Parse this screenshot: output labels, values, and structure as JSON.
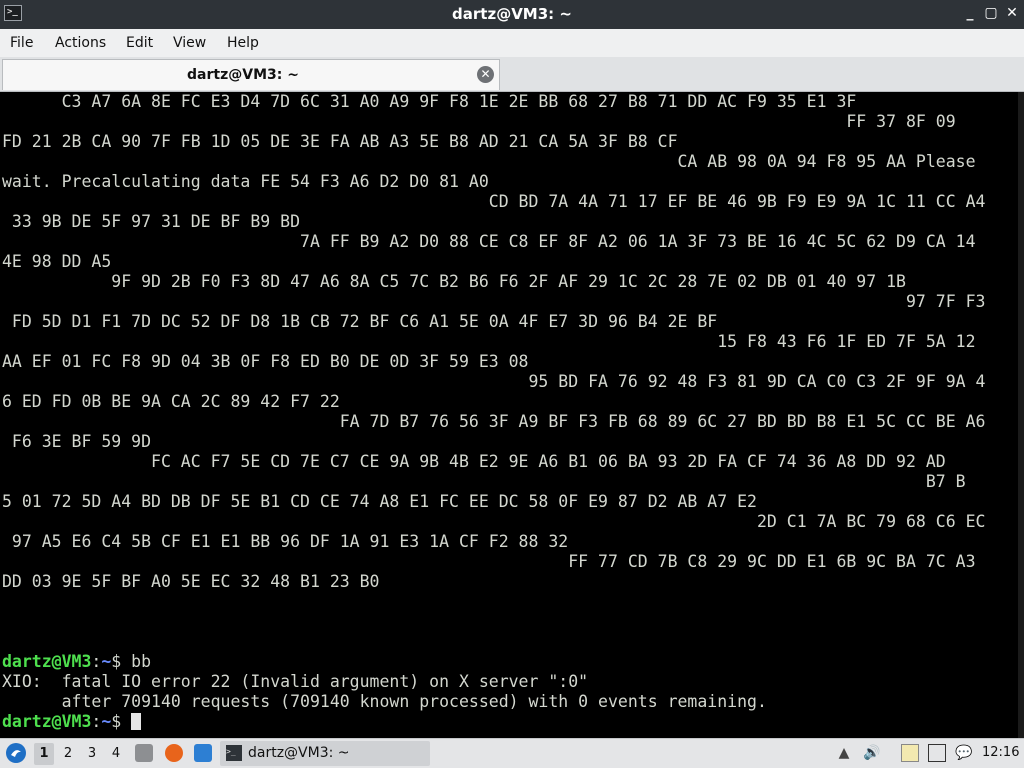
{
  "window": {
    "title": "dartz@VM3: ~",
    "controls": [
      "_",
      "▢",
      "✕"
    ]
  },
  "menu": [
    "File",
    "Actions",
    "Edit",
    "View",
    "Help"
  ],
  "tab": {
    "label": "dartz@VM3: ~",
    "close": "✕"
  },
  "terminal": {
    "lines": [
      "      C3 A7 6A 8E FC E3 D4 7D 6C 31 A0 A9 9F F8 1E 2E BB 68 27 B8 71 DD AC F9 35 E1 3F",
      "                                                                                     FF 37 8F 09",
      "FD 21 2B CA 90 7F FB 1D 05 DE 3E FA AB A3 5E B8 AD 21 CA 5A 3F B8 CF",
      "                                                                    CA AB 98 0A 94 F8 95 AA Please",
      "wait. Precalculating data FE 54 F3 A6 D2 D0 81 A0",
      "                                                 CD BD 7A 4A 71 17 EF BE 46 9B F9 E9 9A 1C 11 CC A4",
      " 33 9B DE 5F 97 31 DE BF B9 BD",
      "                              7A FF B9 A2 D0 88 CE C8 EF 8F A2 06 1A 3F 73 BE 16 4C 5C 62 D9 CA 14",
      "4E 98 DD A5",
      "           9F 9D 2B F0 F3 8D 47 A6 8A C5 7C B2 B6 F6 2F AF 29 1C 2C 28 7E 02 DB 01 40 97 1B",
      "                                                                                           97 7F F3",
      " FD 5D D1 F1 7D DC 52 DF D8 1B CB 72 BF C6 A1 5E 0A 4F E7 3D 96 B4 2E BF",
      "                                                                        15 F8 43 F6 1F ED 7F 5A 12",
      "AA EF 01 FC F8 9D 04 3B 0F F8 ED B0 DE 0D 3F 59 E3 08",
      "                                                     95 BD FA 76 92 48 F3 81 9D CA C0 C3 2F 9F 9A 4",
      "6 ED FD 0B BE 9A CA 2C 89 42 F7 22",
      "                                  FA 7D B7 76 56 3F A9 BF F3 FB 68 89 6C 27 BD BD B8 E1 5C CC BE A6",
      " F6 3E BF 59 9D",
      "               FC AC F7 5E CD 7E C7 CE 9A 9B 4B E2 9E A6 B1 06 BA 93 2D FA CF 74 36 A8 DD 92 AD",
      "                                                                                             B7 B",
      "5 01 72 5D A4 BD DB DF 5E B1 CD CE 74 A8 E1 FC EE DC 58 0F E9 87 D2 AB A7 E2",
      "                                                                            2D C1 7A BC 79 68 C6 EC",
      " 97 A5 E6 C4 5B CF E1 E1 BB 96 DF 1A 91 E3 1A CF F2 88 32",
      "                                                         FF 77 CD 7B C8 29 9C DD E1 6B 9C BA 7C A3",
      "DD 03 9E 5F BF A0 5E EC 32 48 B1 23 B0",
      "",
      "",
      ""
    ],
    "prompt_user": "dartz@VM3",
    "prompt_sep": ":",
    "prompt_path": "~",
    "prompt_dollar": "$ ",
    "command1": "bb",
    "error_line1": "XIO:  fatal IO error 22 (Invalid argument) on X server \":0\"",
    "error_line2": "      after 709140 requests (709140 known processed) with 0 events remaining.",
    "colors": {
      "user": "#4ee04e",
      "path": "#6a8cff",
      "text": "#d3d7cf",
      "background": "#000000"
    }
  },
  "taskbar": {
    "desktops": [
      "1",
      "2",
      "3",
      "4"
    ],
    "active_desktop": "1",
    "launchers": [
      "file-manager-icon",
      "firefox-icon",
      "desktop-icon"
    ],
    "task_label": "dartz@VM3: ~",
    "tray_icons": [
      "tray-app-icon",
      "volume-icon",
      "clipboard-icon",
      "network-icon",
      "notification-icon"
    ],
    "clock": "12:16"
  }
}
